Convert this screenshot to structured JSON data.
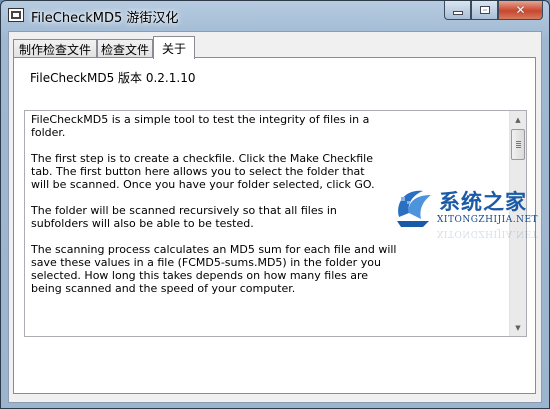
{
  "window": {
    "title": "FileCheckMD5 游街汉化",
    "icon": "app-icon",
    "controls": {
      "minimize": "minimize-icon",
      "maximize": "maximize-icon",
      "close": "close-icon"
    }
  },
  "tabs": [
    {
      "label": "制作检查文件",
      "active": false
    },
    {
      "label": "检查文件",
      "active": false
    },
    {
      "label": "关于",
      "active": true
    }
  ],
  "about": {
    "version_text": "FileCheckMD5 版本 0.2.1.10",
    "paragraphs": [
      "FileCheckMD5 is a simple tool to test the integrity of files in a\nfolder.",
      "The first step is to create a checkfile. Click the Make Checkfile\ntab.  The first button here allows you to select the folder that\nwill be scanned.  Once you have your folder selected, click GO.",
      "The folder will be scanned recursively so that all files in\nsubfolders will also be able to be tested.",
      "The scanning process calculates an MD5 sum for each file and will\nsave these values in a file (FCMD5-sums.MD5) in the folder you\nselected.  How long this takes depends on how many files are\nbeing scanned and the speed of your computer."
    ]
  },
  "watermark": {
    "name_cn": "系统之家",
    "name_en": "XITONGZHIJIA.NET"
  },
  "colors": {
    "titlebar": "#a9c0d8",
    "close_button": "#c7472e",
    "watermark_blue": "#1a5aa6"
  }
}
